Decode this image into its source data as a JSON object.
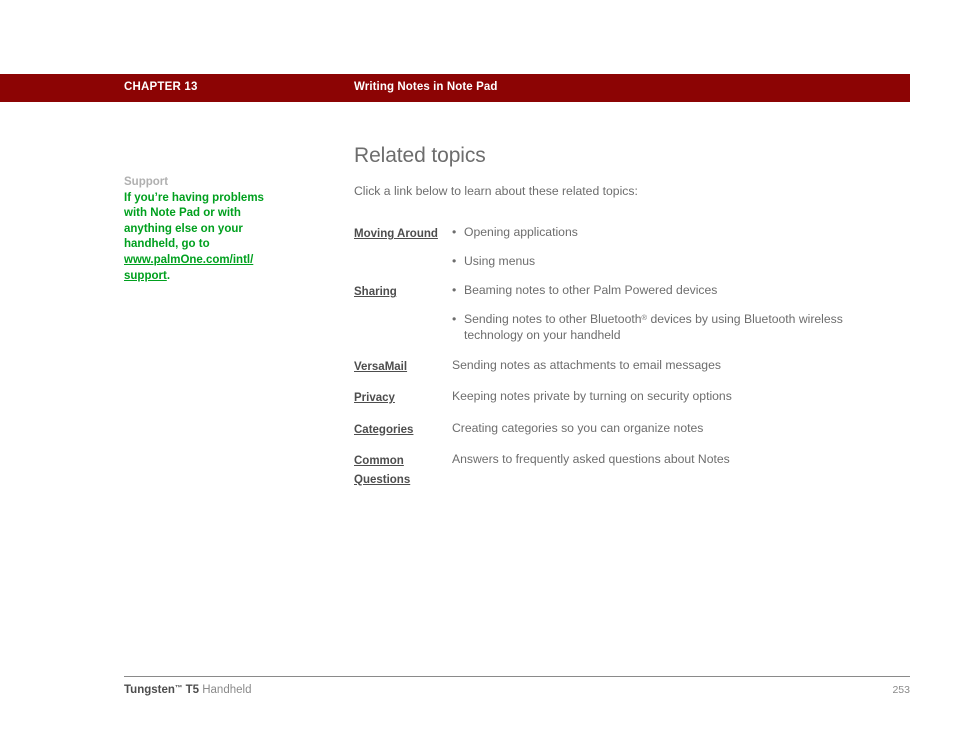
{
  "header": {
    "chapter_number": "CHAPTER 13",
    "chapter_title": "Writing Notes in Note Pad",
    "bar_color": "#8c0404"
  },
  "sidebar": {
    "heading": "Support",
    "body_line1": "If you’re having problems",
    "body_line2": "with Note Pad or with",
    "body_line3": "anything else on your",
    "body_line4": "handheld, go to ",
    "link_text": "www.palmOne.com/intl/ support",
    "after_link": ".",
    "link_color": "#00a01e",
    "heading_color": "#b0b0b0"
  },
  "main": {
    "title": "Related topics",
    "intro": "Click a link below to learn about these related topics:"
  },
  "topics": [
    {
      "link": "Moving Around",
      "bullets": [
        "Opening applications",
        "Using menus"
      ]
    },
    {
      "link": "Sharing",
      "bullets": [
        "Beaming notes to other Palm Powered devices",
        "Sending notes to other Bluetooth® devices by using Bluetooth wireless technology on your handheld"
      ]
    },
    {
      "link": "VersaMail",
      "description": "Sending notes as attachments to email messages"
    },
    {
      "link": "Privacy",
      "description": "Keeping notes private by turning on security options"
    },
    {
      "link": "Categories",
      "description": "Creating categories so you can organize notes"
    },
    {
      "link": "Common Questions",
      "description": "Answers to frequently asked questions about Notes"
    }
  ],
  "bullet_glyph": "•",
  "footer": {
    "brand": "Tungsten",
    "trademark": "™",
    "model": " T5",
    "product_suffix": " Handheld",
    "page_number": "253"
  }
}
